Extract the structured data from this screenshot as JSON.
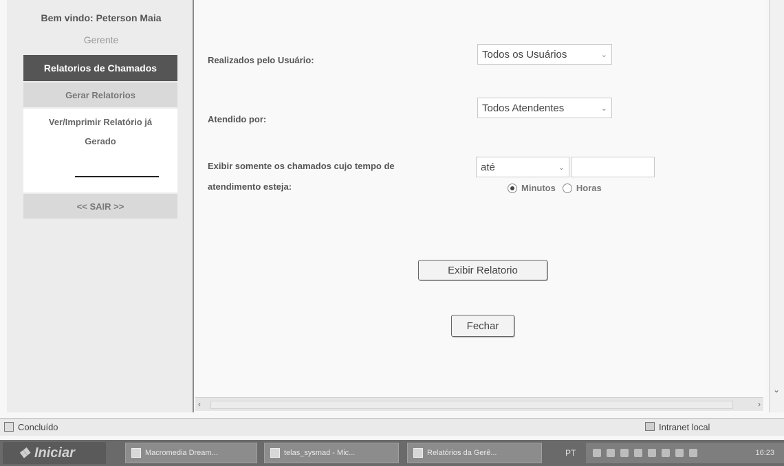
{
  "sidebar": {
    "welcome": "Bem vindo: Peterson Maia",
    "role": "Gerente",
    "menu_header": "Relatorios de Chamados",
    "items": [
      {
        "label": "Gerar Relatorios"
      },
      {
        "label_line1": "Ver/Imprimir Relatório já",
        "label_line2": "Gerado"
      }
    ],
    "logout": "<< SAIR >>"
  },
  "form": {
    "user_label": "Realizados pelo Usuário:",
    "user_select": "Todos os Usuários",
    "attendant_label": "Atendido por:",
    "attendant_select": "Todos Atendentes",
    "time_label_line1": "Exibir somente os chamados cujo tempo de",
    "time_label_line2": "atendimento esteja:",
    "time_select": "até",
    "time_value": "",
    "unit_minutes": "Minutos",
    "unit_hours": "Horas",
    "selected_unit": "Minutos",
    "show_button": "Exibir Relatorio",
    "close_button": "Fechar"
  },
  "statusbar": {
    "status": "Concluído",
    "zone": "Intranet local"
  },
  "taskbar": {
    "start": "Iniciar",
    "tasks": [
      "Macromedia Dream...",
      "telas_sysmad - Mic...",
      "Relatórios da Gerê..."
    ],
    "language": "PT",
    "clock": "16:23"
  }
}
